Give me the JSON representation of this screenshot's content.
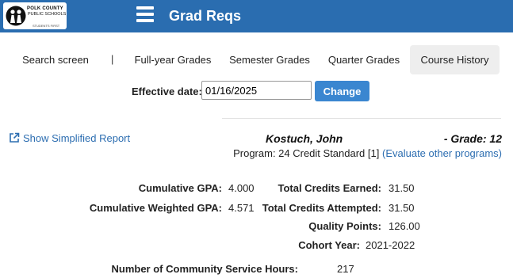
{
  "header": {
    "logo": {
      "line1": "POLK COUNTY",
      "line2": "PUBLIC SCHOOLS",
      "line3": "",
      "tagline": "STUDENTS FIRST"
    },
    "title": "Grad Reqs",
    "colors": {
      "bar": "#2a6db0",
      "accent_button": "#3a86d0",
      "link": "#2d6eb1"
    }
  },
  "tabs": [
    {
      "label": "Search screen",
      "active": false
    },
    {
      "label": "Full-year Grades",
      "active": false
    },
    {
      "label": "Semester Grades",
      "active": false
    },
    {
      "label": "Quarter Grades",
      "active": false
    },
    {
      "label": "Course History",
      "active": true
    }
  ],
  "tab_separator": "|",
  "effective_date": {
    "label": "Effective date:",
    "value": "01/16/2025",
    "button_label": "Change"
  },
  "report": {
    "simplified_link": "Show Simplified Report",
    "student_name": "Kostuch, John",
    "grade": "- Grade: 12",
    "program_text": "Program: 24 Credit Standard [1]",
    "program_link": "(Evaluate other programs)"
  },
  "stats": {
    "cumulative_gpa_label": "Cumulative GPA:",
    "cumulative_gpa_value": "4.000",
    "weighted_gpa_label": "Cumulative Weighted GPA:",
    "weighted_gpa_value": "4.571",
    "credits_earned_label": "Total Credits Earned:",
    "credits_earned_value": "31.50",
    "credits_attempted_label": "Total Credits Attempted:",
    "credits_attempted_value": "31.50",
    "quality_points_label": "Quality Points:",
    "quality_points_value": "126.00",
    "cohort_year_label": "Cohort Year:",
    "cohort_year_value": "2021-2022",
    "service_hours_label": "Number of Community Service Hours:",
    "service_hours_value": "217"
  }
}
